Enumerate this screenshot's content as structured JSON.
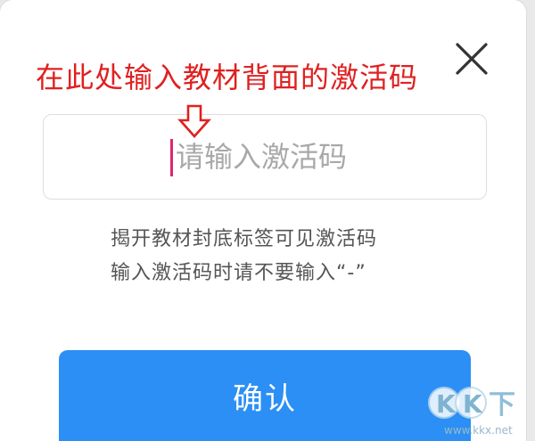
{
  "annotation": {
    "text": "在此处输入教材背面的激活码",
    "color": "#e02020",
    "arrow_icon": "down-arrow-icon"
  },
  "dialog": {
    "close_icon": "close-icon",
    "input": {
      "value": "",
      "placeholder": "请输入激活码"
    },
    "hints": [
      "揭开教材封底标签可见激活码",
      "输入激活码时请不要输入“-”"
    ],
    "confirm_label": "确认",
    "accent_color": "#2b8ff5"
  },
  "watermark": {
    "logo_text": "KK下载",
    "url": "www.kkx.net"
  }
}
